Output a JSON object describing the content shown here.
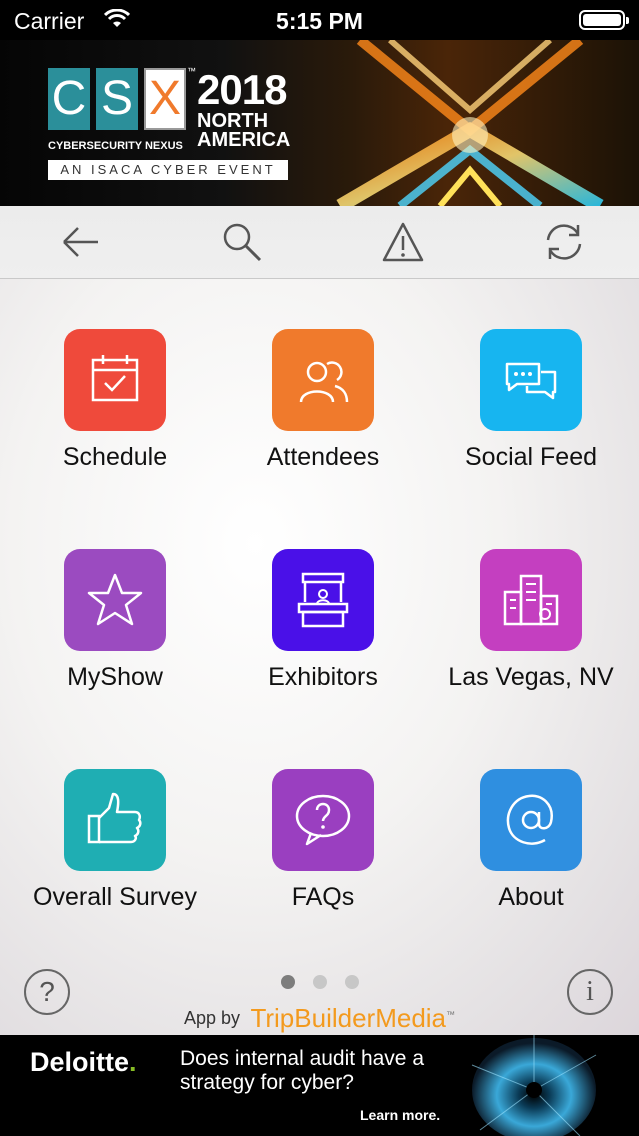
{
  "status_bar": {
    "carrier": "Carrier",
    "time": "5:15 PM"
  },
  "banner": {
    "logo_letters": [
      "C",
      "S",
      "X"
    ],
    "trademark": "™",
    "year": "2018",
    "region_line1": "NORTH",
    "region_line2": "AMERICA",
    "subtitle": "CYBERSECURITY NEXUS",
    "tagline": "AN ISACA CYBER EVENT"
  },
  "toolbar": {
    "icons": [
      "back-arrow-icon",
      "search-icon",
      "alert-triangle-icon",
      "refresh-icon"
    ]
  },
  "grid": {
    "tiles": [
      {
        "label": "Schedule",
        "icon": "calendar-check-icon",
        "color": "#ef4a3b"
      },
      {
        "label": "Attendees",
        "icon": "people-icon",
        "color": "#f07a2c"
      },
      {
        "label": "Social Feed",
        "icon": "chat-bubbles-icon",
        "color": "#17b5f0"
      },
      {
        "label": "MyShow",
        "icon": "star-icon",
        "color": "#9b4bc0"
      },
      {
        "label": "Exhibitors",
        "icon": "booth-icon",
        "color": "#4a10e8"
      },
      {
        "label": "Las Vegas, NV",
        "icon": "city-buildings-icon",
        "color": "#c43fc0"
      },
      {
        "label": "Overall Survey",
        "icon": "thumbs-up-icon",
        "color": "#1faeb3"
      },
      {
        "label": "FAQs",
        "icon": "question-bubble-icon",
        "color": "#9a3fc0"
      },
      {
        "label": "About",
        "icon": "at-sign-icon",
        "color": "#2f8fe0"
      }
    ]
  },
  "pager": {
    "pages": 3,
    "current": 1
  },
  "footer": {
    "help_glyph": "?",
    "info_glyph": "i",
    "app_by": "App by",
    "brand_part1": "TripBuilder",
    "brand_part2": "Media",
    "brand_mark": "™"
  },
  "ad": {
    "brand": "Deloitte",
    "brand_dot": ".",
    "text": "Does internal audit have a strategy for cyber?",
    "cta": "Learn more."
  }
}
